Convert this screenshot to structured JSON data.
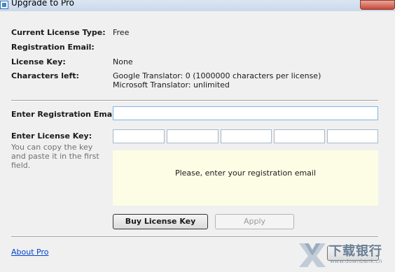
{
  "window": {
    "title": "Upgrade to Pro"
  },
  "license": {
    "type_label": "Current License Type:",
    "type_value": "Free",
    "email_label": "Registration Email:",
    "key_label": "License Key:",
    "key_value": "None",
    "chars_label": "Characters left:",
    "google_line": "Google Translator: 0 (1000000 characters per license)",
    "microsoft_line": "Microsoft Translator: unlimited"
  },
  "form": {
    "email_label": "Enter Registration Email:",
    "email_value": "",
    "key_label": "Enter License Key:",
    "key_hint": "You can copy the key and paste it in the first field.",
    "key_fields": [
      "",
      "",
      "",
      "",
      ""
    ]
  },
  "message": "Please, enter your registration email",
  "buttons": {
    "buy": "Buy License Key",
    "apply": "Apply"
  },
  "footer": {
    "about_link": "About Pro"
  },
  "watermark": {
    "text": "下载银行",
    "url": "www.downbank.cn"
  }
}
